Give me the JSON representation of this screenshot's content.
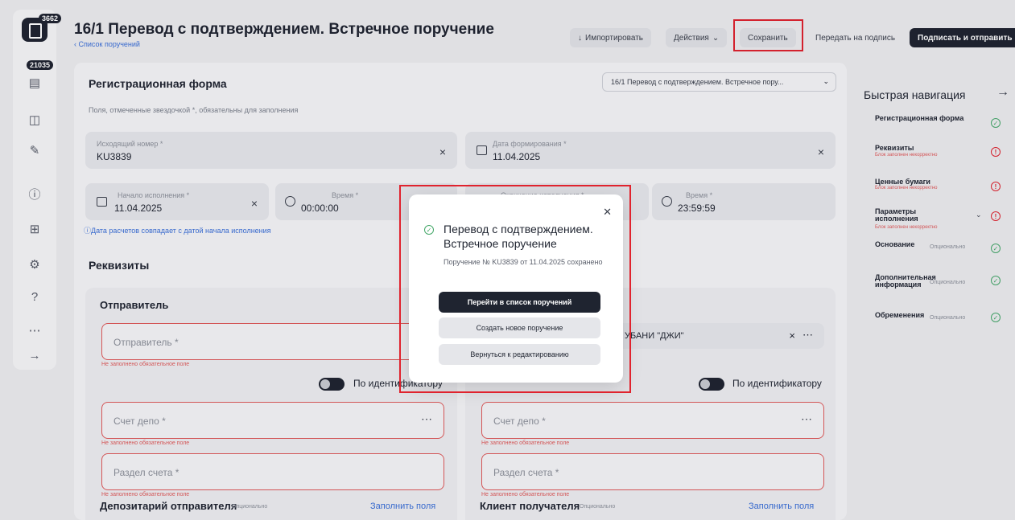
{
  "header": {
    "title": "16/1 Перевод с подтверждением. Встречное поручение",
    "breadcrumb": "‹ Список поручений",
    "import_label": "Импортировать",
    "actions_label": "Действия",
    "save_label": "Сохранить",
    "send_sign_label": "Передать на подпись",
    "sign_send_label": "Подписать и отправить"
  },
  "rail": {
    "badge_main": "3662",
    "badge_second": "21035"
  },
  "form": {
    "reg_title": "Регистрационная форма",
    "template_select": "16/1 Перевод с подтверждением. Встречное пору...",
    "required_hint": "Поля, отмеченные звездочкой *, обязательны для заполнения",
    "outgoing_label": "Исходящий номер *",
    "outgoing_value": "KU3839",
    "formed_label": "Дата формирования *",
    "formed_value": "11.04.2025",
    "start_label": "Начало исполнения *",
    "start_value": "11.04.2025",
    "start_time_label": "Время *",
    "start_time_value": "00:00:00",
    "end_label": "Окончание исполнения *",
    "end_time_label": "Время *",
    "end_time_value": "23:59:59",
    "settlement_hint": "ⓘДата расчетов совпадает с датой начала исполнения",
    "requisites_title": "Реквизиты",
    "sender_title": "Отправитель",
    "sender_placeholder": "Отправитель *",
    "required_error": "Не заполнено обязательное поле",
    "by_identifier": "По идентификатору",
    "receiver_value": "УБАНИ \"ДЖИ\"",
    "depo_placeholder": "Счет депо *",
    "section_placeholder": "Раздел счета *",
    "sender_depositary": "Депозитарий отправителя",
    "receiver_client": "Клиент получателя",
    "optional": "Опционально",
    "fill_fields": "Заполнить поля"
  },
  "quick_nav": {
    "title": "Быстрая навигация",
    "items": [
      {
        "label": "Регистрационная форма",
        "status": "ok"
      },
      {
        "label": "Реквизиты",
        "sub": "Блок заполнен некорректно",
        "status": "bad"
      },
      {
        "label": "Ценные бумаги",
        "sub": "Блок заполнен некорректно",
        "status": "bad"
      },
      {
        "label": "Параметры исполнения",
        "sub": "Блок заполнен некорректно",
        "status": "bad"
      },
      {
        "label": "Основание",
        "opt": "Опционально",
        "status": "ok"
      },
      {
        "label": "Дополнительная информация",
        "opt": "Опционально",
        "status": "ok"
      },
      {
        "label": "Обременения",
        "opt": "Опционально",
        "status": "ok"
      }
    ]
  },
  "modal": {
    "title": "Перевод с подтверждением. Встречное поручение",
    "text": "Поручение № KU3839 от 11.04.2025 сохранено",
    "btn_list": "Перейти в список поручений",
    "btn_new": "Создать новое поручение",
    "btn_back": "Вернуться к редактированию"
  },
  "colors": {
    "accent_dark": "#1f2430",
    "error": "#e0232e",
    "ok": "#46a86a",
    "link": "#3a6fd8"
  }
}
